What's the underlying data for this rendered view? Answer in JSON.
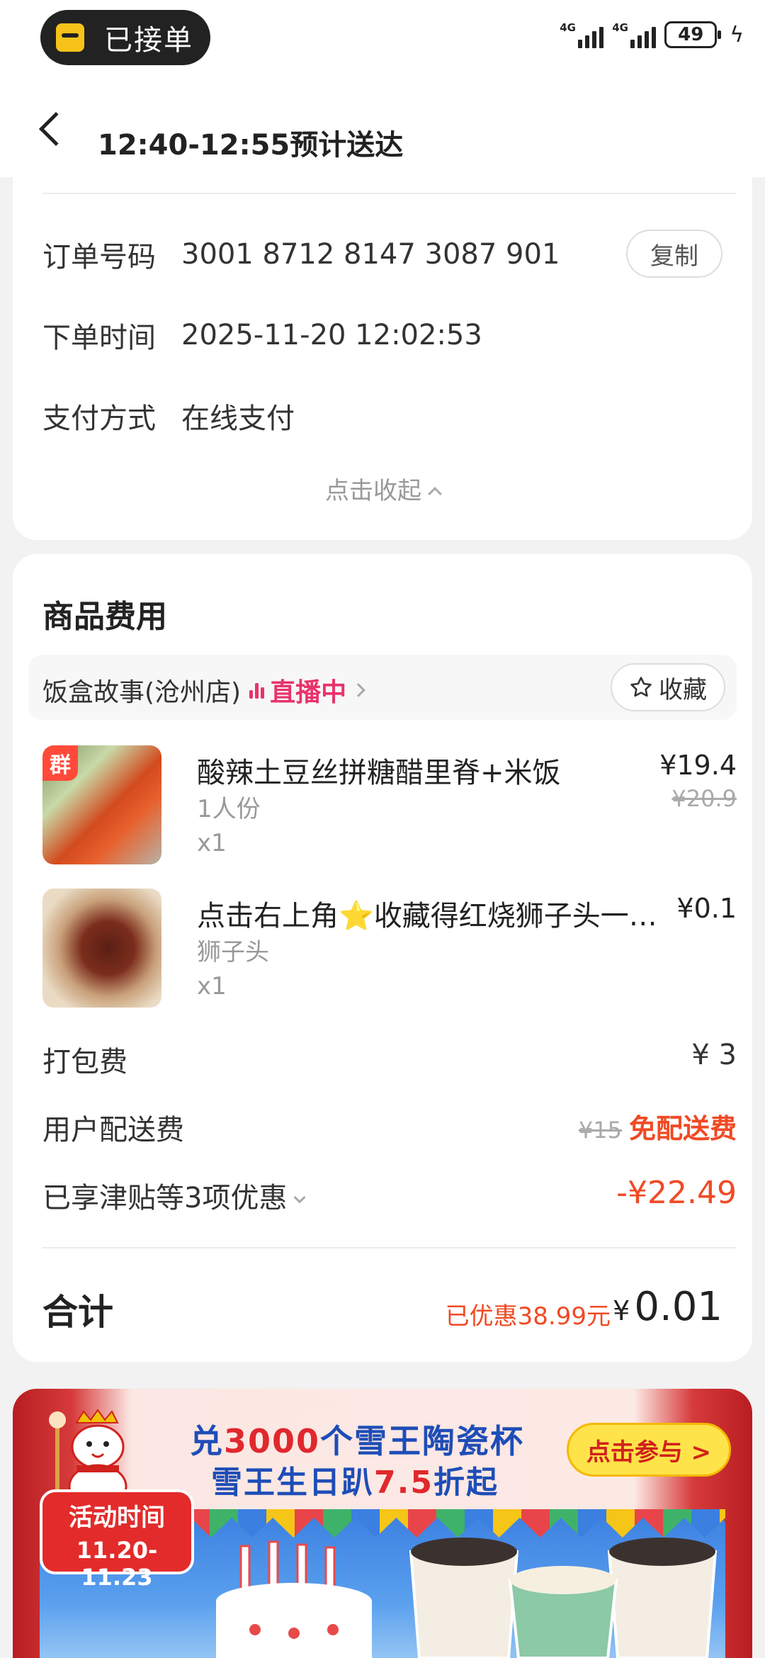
{
  "status_bar": {
    "pill_label": "已接单",
    "network1": "4G",
    "network2": "4G",
    "battery": "49"
  },
  "header": {
    "title": "12:40-12:55预计送达"
  },
  "order_info": {
    "order_no_label": "订单号码",
    "order_no": "3001 8712 8147 3087 901",
    "copy_label": "复制",
    "time_label": "下单时间",
    "time": "2025-11-20 12:02:53",
    "pay_label": "支付方式",
    "pay": "在线支付",
    "collapse_label": "点击收起"
  },
  "fees": {
    "section_title": "商品费用",
    "shop_name": "饭盒故事(沧州店)",
    "live_label": "直播中",
    "fav_label": "收藏",
    "items": [
      {
        "badge": "群",
        "name": "酸辣土豆丝拼糖醋里脊+米饭",
        "spec": "1人份",
        "qty": "x1",
        "price": "¥19.4",
        "orig_price": "¥20.9"
      },
      {
        "name_prefix": "点击右上角",
        "name_star": "⭐",
        "name_suffix": "收藏得红烧狮子头一…",
        "spec": "狮子头",
        "qty": "x1",
        "price": "¥0.1"
      }
    ],
    "packing_label": "打包费",
    "packing_value": "¥ 3",
    "delivery_label": "用户配送费",
    "delivery_orig": "¥15",
    "delivery_value": "免配送费",
    "discount_label": "已享津贴等3项优惠",
    "discount_value": "-¥22.49",
    "total_label": "合计",
    "saved_label": "已优惠38.99元",
    "total_currency": "¥",
    "total_value": "0.01"
  },
  "banner": {
    "line1_a": "兑",
    "line1_b": "3000",
    "line1_c": "个雪王陶瓷杯",
    "line2_a": "雪王生日趴",
    "line2_b": "7.5",
    "line2_c": "折起",
    "join_label": "点击参与 >",
    "event_title": "活动时间",
    "event_dates": "11.20-11.23"
  },
  "colors": {
    "accent_red": "#f04a24",
    "live_pink": "#e8336a",
    "banner_blue": "#1e4db7"
  }
}
